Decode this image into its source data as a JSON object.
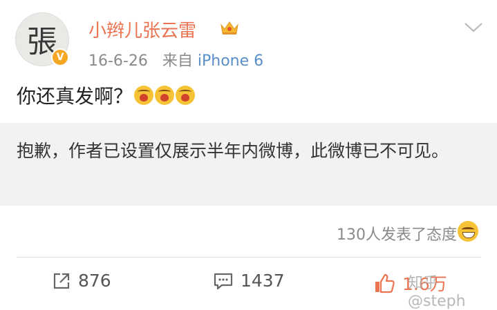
{
  "post": {
    "avatar_glyph": "張",
    "verified_badge": "V",
    "username": "小辫儿张云雷",
    "crown_icon": "crown-icon",
    "date": "16-6-26",
    "source_prefix": "来自",
    "source_device": "iPhone 6",
    "content_text": "你还真发啊？",
    "content_emojis": [
      "crying-face-emoji",
      "crying-face-emoji",
      "crying-face-emoji"
    ]
  },
  "notice": {
    "text": "抱歉，作者已设置仅展示半年内微博，此微博已不可见。"
  },
  "reactions": {
    "summary": "130人发表了态度"
  },
  "actions": {
    "repost_count": "876",
    "comment_count": "1437",
    "like_count": "1.6万"
  },
  "watermark": "知乎 @steph",
  "colors": {
    "username": "#eb7350",
    "source": "#5a8ec9",
    "like_active": "#eb7350",
    "notice_bg": "#f2f2f2"
  }
}
